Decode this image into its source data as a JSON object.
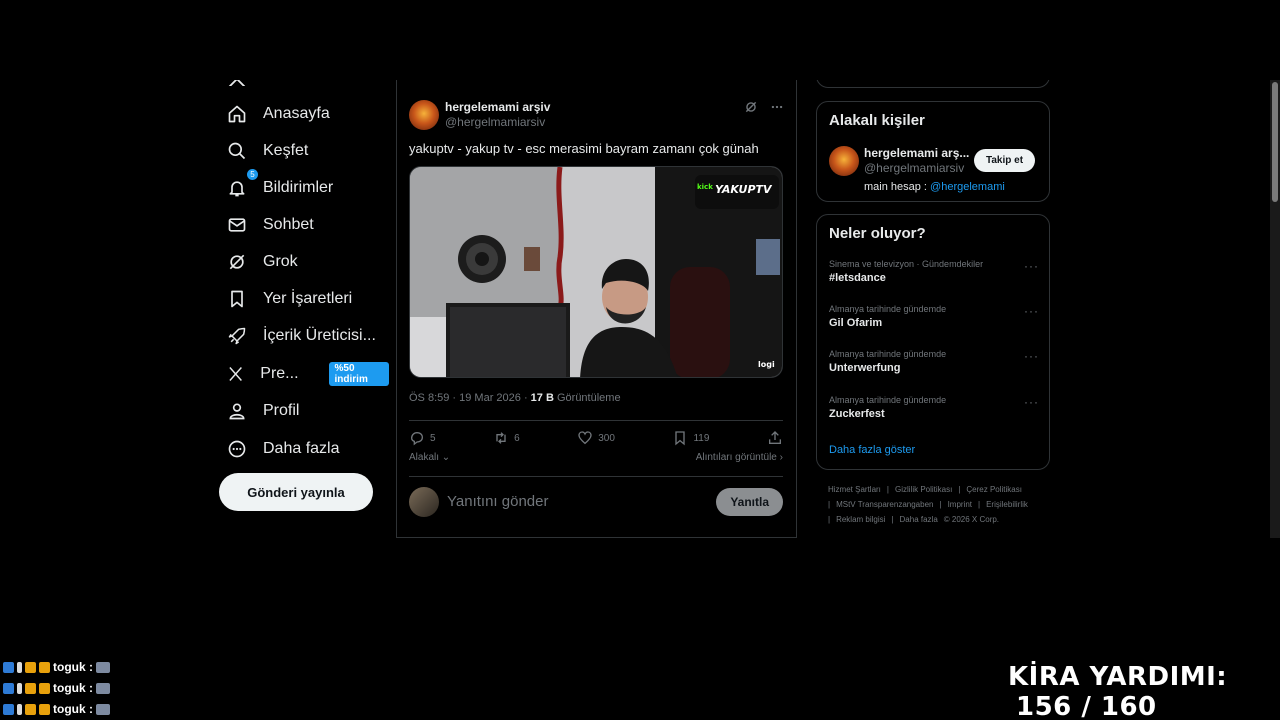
{
  "nav": {
    "items": [
      {
        "label": "Anasayfa",
        "icon": "home-icon"
      },
      {
        "label": "Keşfet",
        "icon": "search-icon"
      },
      {
        "label": "Bildirimler",
        "icon": "bell-icon",
        "badge": "5"
      },
      {
        "label": "Sohbet",
        "icon": "mail-icon"
      },
      {
        "label": "Grok",
        "icon": "grok-icon"
      },
      {
        "label": "Yer İşaretleri",
        "icon": "bookmark-icon"
      },
      {
        "label": "İçerik Üreticisi...",
        "icon": "rocket-icon"
      },
      {
        "label": "Pre...",
        "icon": "x-logo-icon",
        "promo": "%50 indirim"
      },
      {
        "label": "Profil",
        "icon": "person-icon"
      },
      {
        "label": "Daha fazla",
        "icon": "more-circle-icon"
      }
    ],
    "post_button": "Gönderi yayınla"
  },
  "tweet": {
    "name": "hergelemami arşiv",
    "handle": "@hergelmamiarsiv",
    "text": "yakuptv - yakup tv - esc merasimi bayram zamanı çok günah",
    "time": "ÖS 8:59 · 19 Mar 2026 · ",
    "views_count": "17 B",
    "views_label": " Görüntüleme",
    "media_logo": "YAKUPTV",
    "media_watermark": "logi",
    "stats": {
      "replies": "5",
      "retweets": "6",
      "likes": "300",
      "bookmarks": "119"
    },
    "related_label": "Alakalı",
    "quotes_label": "Alıntıları görüntüle"
  },
  "reply": {
    "placeholder": "Yanıtını gönder",
    "button": "Yanıtla"
  },
  "related_people": {
    "title": "Alakalı kişiler",
    "name": "hergelemami arş...",
    "handle": "@hergelmamiarsiv",
    "follow": "Takip et",
    "bio_prefix": "main hesap : ",
    "bio_link": "@hergelemami"
  },
  "trends": {
    "title": "Neler oluyor?",
    "items": [
      {
        "context": "Sinema ve televizyon · Gündemdekiler",
        "name": "#letsdance"
      },
      {
        "context": "Almanya tarihinde gündemde",
        "name": "Gil Ofarim"
      },
      {
        "context": "Almanya tarihinde gündemde",
        "name": "Unterwerfung"
      },
      {
        "context": "Almanya tarihinde gündemde",
        "name": "Zuckerfest"
      }
    ],
    "show_more": "Daha fazla göster"
  },
  "footer": {
    "links": [
      "Hizmet Şartları",
      "Gizlilik Politikası",
      "Çerez Politikası",
      "MStV Transparenzangaben",
      "Imprint",
      "Erişilebilirlik",
      "Reklam bilgisi"
    ],
    "more": "Daha fazla",
    "copyright": "© 2026 X Corp."
  },
  "overlay": {
    "chat_user": "toguk :",
    "counter_label": "KİRA YARDIMI:",
    "counter_value": "156 / 160"
  },
  "colors": {
    "accent": "#1d9bf0",
    "background": "#000000",
    "border": "#2f3336",
    "muted": "#71767b"
  }
}
